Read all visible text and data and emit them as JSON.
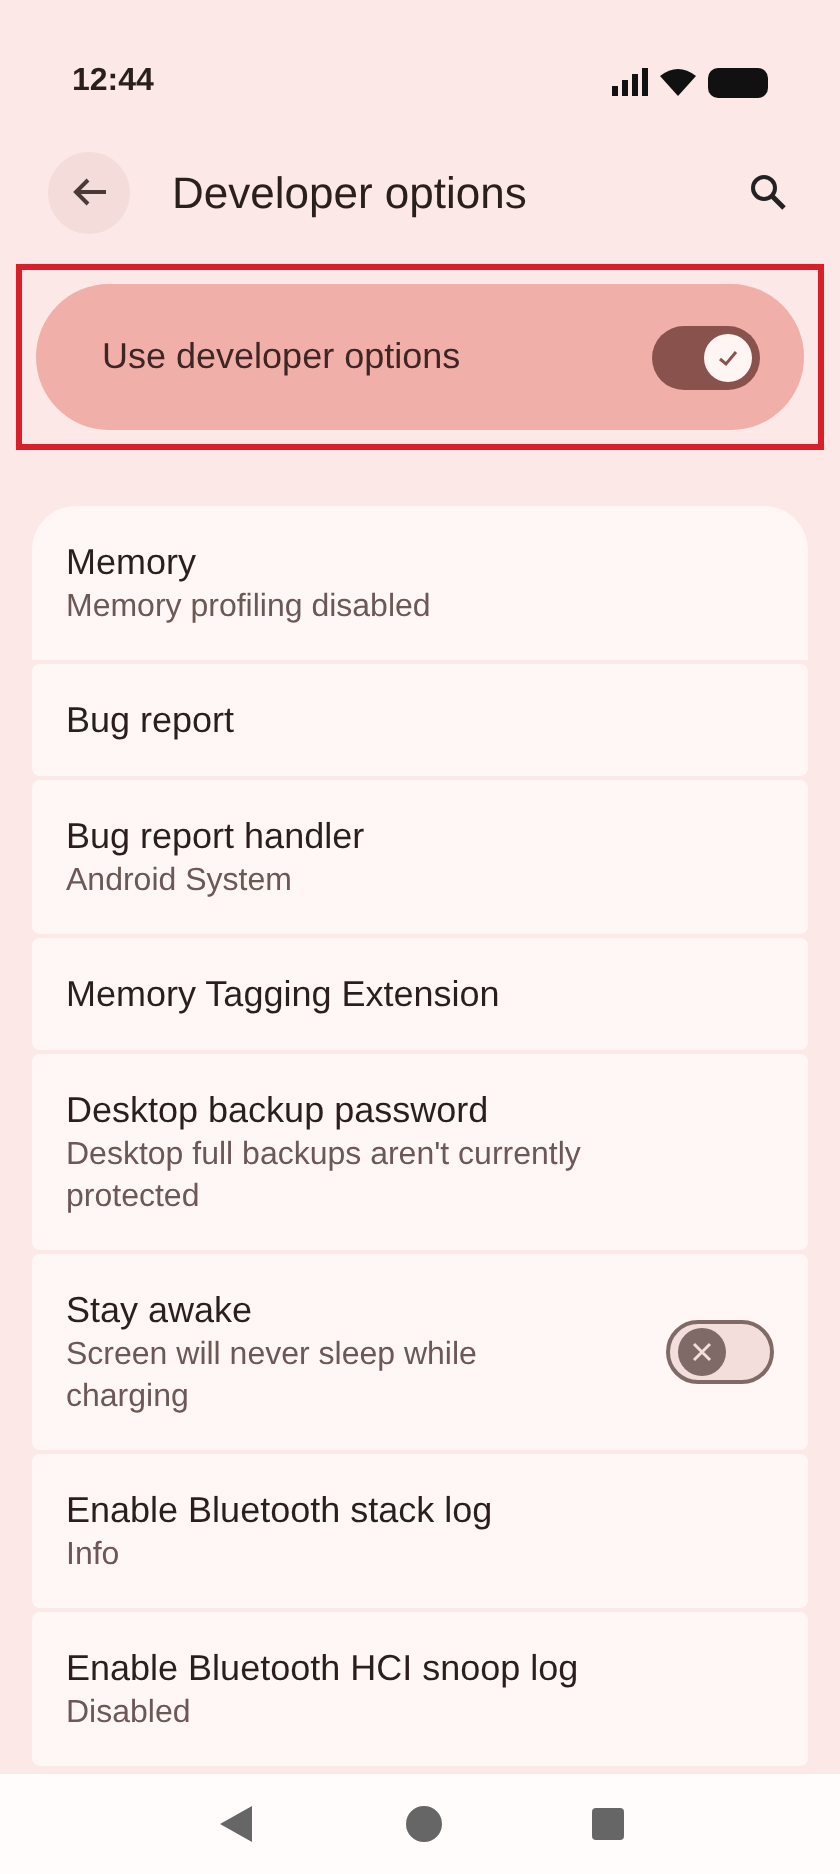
{
  "status_bar": {
    "time": "12:44"
  },
  "header": {
    "title": "Developer options"
  },
  "master_switch": {
    "label": "Use developer options",
    "on": true,
    "highlighted": true
  },
  "settings": [
    {
      "kind": "plain",
      "title": "Memory",
      "subtitle": "Memory profiling disabled"
    },
    {
      "kind": "plain",
      "title": "Bug report"
    },
    {
      "kind": "plain",
      "title": "Bug report handler",
      "subtitle": "Android System"
    },
    {
      "kind": "plain",
      "title": "Memory Tagging Extension"
    },
    {
      "kind": "plain",
      "title": "Desktop backup password",
      "subtitle": "Desktop full backups aren't currently protected"
    },
    {
      "kind": "toggle",
      "title": "Stay awake",
      "subtitle": "Screen will never sleep while charging",
      "on": false
    },
    {
      "kind": "plain",
      "title": "Enable Bluetooth stack log",
      "subtitle": "Info"
    },
    {
      "kind": "plain",
      "title": "Enable Bluetooth HCI snoop log",
      "subtitle": "Disabled"
    }
  ]
}
